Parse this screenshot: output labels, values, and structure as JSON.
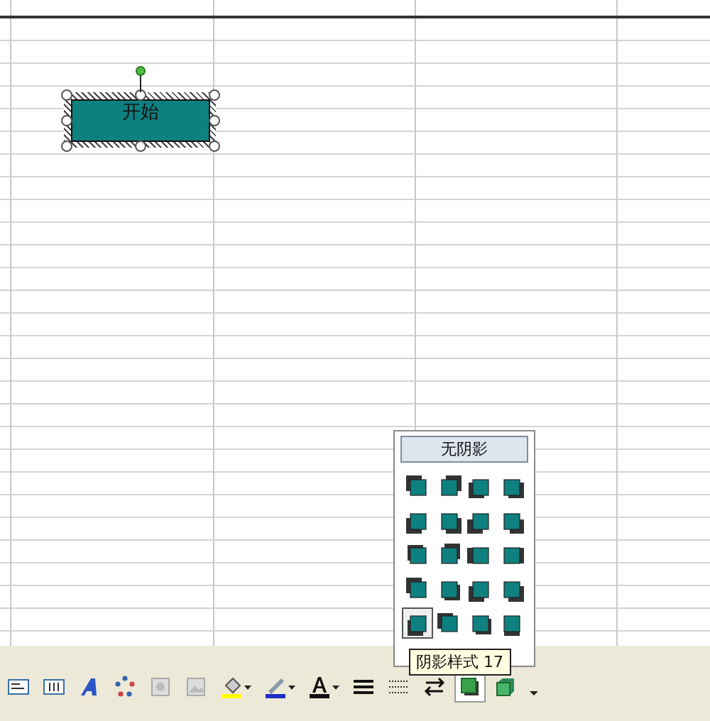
{
  "sheet": {
    "shape": {
      "text": "开始",
      "selected": true
    }
  },
  "shadow_menu": {
    "no_shadow": "无阴影",
    "styles": [
      {
        "selected": false
      },
      {
        "selected": false
      },
      {
        "selected": false
      },
      {
        "selected": false
      },
      {
        "selected": false
      },
      {
        "selected": false
      },
      {
        "selected": false
      },
      {
        "selected": false
      },
      {
        "selected": false
      },
      {
        "selected": false
      },
      {
        "selected": false
      },
      {
        "selected": false
      },
      {
        "selected": false
      },
      {
        "selected": false
      },
      {
        "selected": false
      },
      {
        "selected": false
      },
      {
        "selected": true
      },
      {
        "selected": false
      },
      {
        "selected": false
      },
      {
        "selected": false
      }
    ],
    "tooltip": "阴影样式 17"
  },
  "toolbar": {
    "buttons": [
      {
        "kind": "textbox",
        "pressed": false
      },
      {
        "kind": "vertical-textbox",
        "pressed": false
      },
      {
        "kind": "wordart",
        "pressed": false
      },
      {
        "kind": "diagram",
        "pressed": false
      },
      {
        "kind": "clipart",
        "pressed": false
      },
      {
        "kind": "image",
        "pressed": false
      },
      {
        "kind": "fill-color",
        "pressed": false
      },
      {
        "kind": "line-color",
        "pressed": false
      },
      {
        "kind": "font-color",
        "pressed": false
      },
      {
        "kind": "line-style",
        "pressed": false
      },
      {
        "kind": "dash-style",
        "pressed": false
      },
      {
        "kind": "arrow-style",
        "pressed": false
      },
      {
        "kind": "shadow",
        "pressed": true
      },
      {
        "kind": "threed",
        "pressed": false
      },
      {
        "kind": "more",
        "pressed": false
      }
    ]
  }
}
